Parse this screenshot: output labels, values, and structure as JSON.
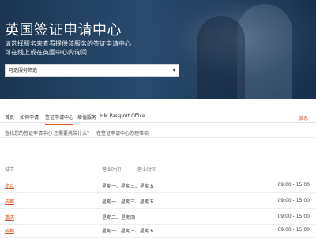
{
  "hero": {
    "title": "英国签证申请中心",
    "subtitle_line1": "请选择服务来查看提供该服务的签证申请中心",
    "subtitle_line2": "可在线上或在英国中心内询问",
    "select_value": "可选服务筛选",
    "select_arrow": "▾"
  },
  "nav": {
    "items": [
      "首页",
      "如何申请",
      "签证申请中心",
      "增值服务",
      "HM Passport Office"
    ],
    "right_link": "联系"
  },
  "subnav": {
    "items": [
      "查找您的签证申请中心",
      "您需要携带什么？",
      "在签证申请中心办理事项"
    ]
  },
  "table": {
    "headers": [
      "城市",
      "营业时间",
      "营业时间"
    ],
    "rows": [
      {
        "city": "北京",
        "days": "星期一、星期三、星期五",
        "hours": "09:00 - 15:00"
      },
      {
        "city": "成都",
        "days": "星期一、星期三、星期五",
        "hours": "09:00 - 15:00"
      },
      {
        "city": "重庆",
        "days": "星期二、星期四",
        "hours": "09:00 - 15:00"
      },
      {
        "city": "成都",
        "days": "星期一、星期三、星期五",
        "hours": "09:00 - 15:00"
      }
    ]
  },
  "colors": {
    "accent": "#d9531e",
    "hero_bg": "#1b3550"
  }
}
